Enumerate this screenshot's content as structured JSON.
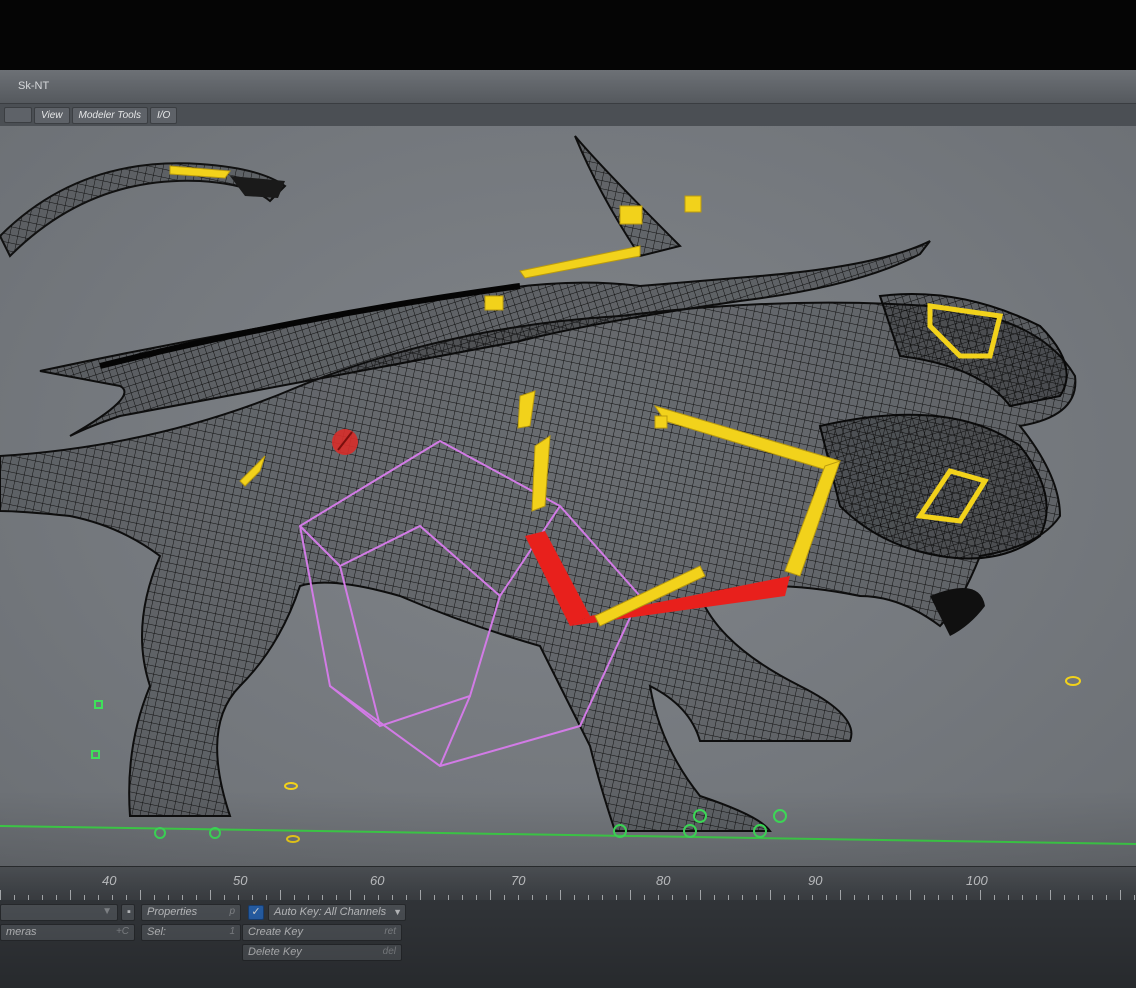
{
  "window": {
    "title": "Sk-NT"
  },
  "menu": {
    "items": [
      {
        "label": ""
      },
      {
        "label": "View"
      },
      {
        "label": "Modeler Tools"
      },
      {
        "label": "I/O"
      }
    ]
  },
  "viewport": {
    "scene": "wireframe-rigged-creature",
    "colors": {
      "background": "#777b80",
      "wireframe": "#111111",
      "bones_yellow": "#f2d21b",
      "bones_red": "#e8201c",
      "cage_pink": "#d27be6",
      "ground_line": "#3fd24a",
      "nulls_green": "#3fe05a"
    }
  },
  "timeline": {
    "ticks": [
      "40",
      "50",
      "60",
      "70",
      "80",
      "90",
      "100"
    ]
  },
  "controls": {
    "item_dropdown": {
      "value": ""
    },
    "cameras_label": "meras",
    "cameras_hint": "+C",
    "properties_label": "Properties",
    "properties_hint": "p",
    "sel_label": "Sel:",
    "sel_value": "1",
    "auto_key_checked": "✓",
    "auto_key_label": "Auto Key: All Channels",
    "create_key_label": "Create Key",
    "create_key_hint": "ret",
    "delete_key_label": "Delete Key",
    "delete_key_hint": "del"
  }
}
